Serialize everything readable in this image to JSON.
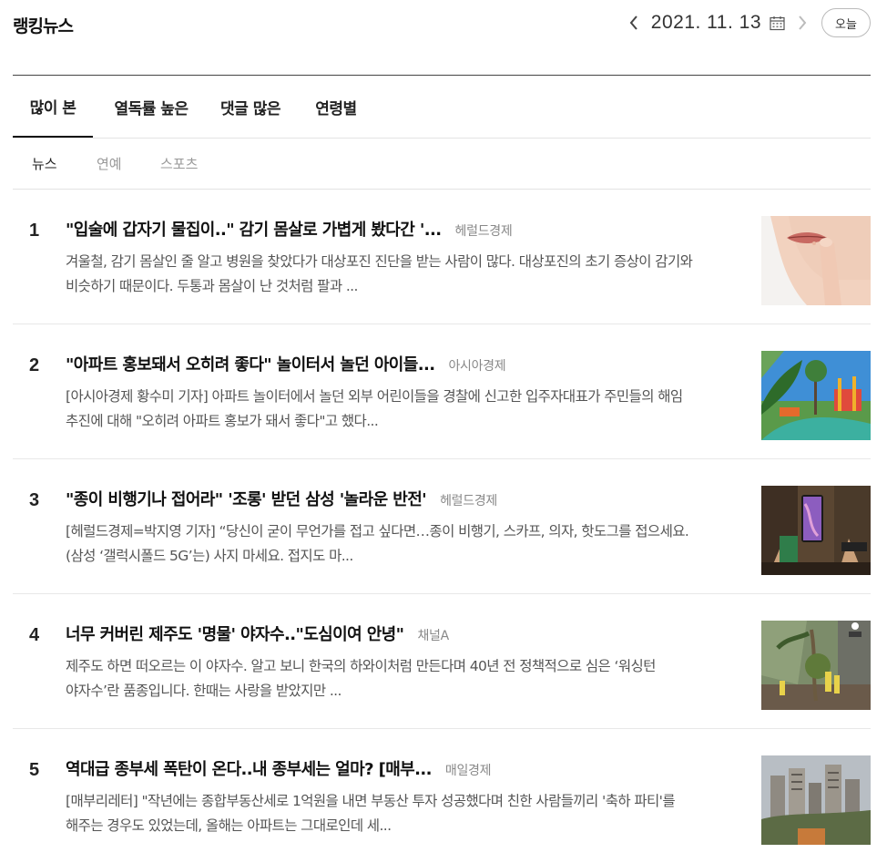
{
  "header": {
    "brand": "랭킹뉴스",
    "date": "2021. 11. 13",
    "today_label": "오늘",
    "icons": {
      "prev": "chevron-left-icon",
      "next": "chevron-right-icon",
      "calendar": "calendar-icon"
    }
  },
  "tabs": [
    "많이 본",
    "열독률 높은",
    "댓글 많은",
    "연령별"
  ],
  "subtabs": [
    "뉴스",
    "연예",
    "스포츠"
  ],
  "articles": [
    {
      "rank": "1",
      "title": "\"입술에 갑자기 물집이..\" 감기 몸살로 가볍게 봤다간 '...",
      "press": "헤럴드경제",
      "summary": "겨울철, 감기 몸살인 줄 알고 병원을 찾았다가 대상포진 진단을 받는 사람이 많다. 대상포진의 초기 증상이 감기와 비슷하기 때문이다. 두통과 몸살이 난 것처럼 팔과 ..."
    },
    {
      "rank": "2",
      "title": "\"아파트 홍보돼서 오히려 좋다\" 놀이터서 놀던 아이들...",
      "press": "아시아경제",
      "summary": "[아시아경제 황수미 기자] 아파트 놀이터에서 놀던 외부 어린이들을 경찰에 신고한 입주자대표가 주민들의 해임 추진에 대해 \"오히려 아파트 홍보가 돼서 좋다\"고 했다..."
    },
    {
      "rank": "3",
      "title": "\"종이 비행기나 접어라\" '조롱' 받던 삼성 '놀라운 반전'",
      "press": "헤럴드경제",
      "summary": "[헤럴드경제=박지영 기자] “당신이 굳이 무언가를 접고 싶다면…종이 비행기, 스카프, 의자, 핫도그를 접으세요. (삼성 ‘갤럭시폴드 5G’는) 사지 마세요. 접지도 마..."
    },
    {
      "rank": "4",
      "title": "너무 커버린 제주도 '명물' 야자수..\"도심이여 안녕\"",
      "press": "채널A",
      "summary": "제주도 하면 떠오르는 이 야자수. 알고 보니 한국의 하와이처럼 만든다며 40년 전 정책적으로 심은 ‘워싱턴 야자수’란 품종입니다. 한때는 사랑을 받았지만 ..."
    },
    {
      "rank": "5",
      "title": "역대급 종부세 폭탄이 온다..내 종부세는 얼마? [매부...",
      "press": "매일경제",
      "summary": "[매부리레터] \"작년에는 종합부동산세로 1억원을 내면 부동산 투자 성공했다며 친한 사람들끼리 '축하 파티'를 해주는 경우도 있었는데, 올해는 아파트는 그대로인데 세..."
    }
  ]
}
